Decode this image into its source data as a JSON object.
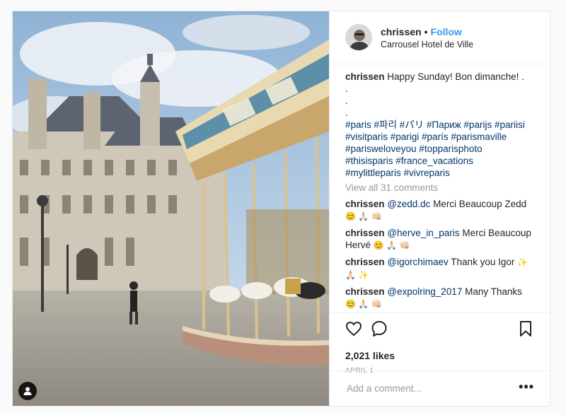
{
  "post": {
    "username": "chrissen",
    "follow_label": "Follow",
    "separator": "•",
    "location": "Carrousel Hotel de Ville",
    "caption": {
      "text": "Happy Sunday! Bon dimanche! .",
      "dots": [
        ".",
        ".",
        "."
      ],
      "hashtag_lines": [
        "#paris #파리 #パリ #Париж #parijs #pariisi",
        "#visitparis #parigi #parís #parismaville",
        "#parisweloveyou #topparisphoto",
        "#thisisparis #france_vacations",
        "#mylittleparis #vivreparis"
      ]
    },
    "view_all_comments": "View all 31 comments",
    "comments": [
      {
        "user": "chrissen",
        "mention": "@zedd.dc",
        "text": "Merci Beaucoup Zedd",
        "emoji": "😊 🙏🏻 👊🏻"
      },
      {
        "user": "chrissen",
        "mention": "@herve_in_paris",
        "text": "Merci Beaucoup Hervé",
        "emoji": "😊 🙏🏻 👊🏻"
      },
      {
        "user": "chrissen",
        "mention": "@igorchimaev",
        "text": "Thank you Igor",
        "emoji": "✨ 🙏🏻 ✨"
      },
      {
        "user": "chrissen",
        "mention": "@expolring_2017",
        "text": "Many Thanks",
        "emoji": "😊 🙏🏻 👊🏻"
      }
    ],
    "likes": "2,021 likes",
    "date": "APRIL 1",
    "add_comment_placeholder": "Add a comment...",
    "more_label": "•••"
  },
  "icons": {
    "like": "heart-icon",
    "comment": "speech-bubble-icon",
    "save": "bookmark-icon",
    "tagged": "user-tag-icon"
  },
  "colors": {
    "accent": "#3897f0",
    "hashtag": "#003569",
    "muted": "#999999",
    "text": "#262626"
  }
}
